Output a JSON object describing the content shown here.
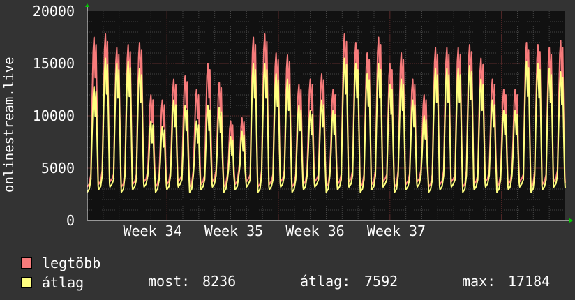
{
  "chart_data": {
    "type": "line",
    "ylabel": "onlinestream.live",
    "ylim": [
      0,
      20000
    ],
    "y_ticks": [
      "0",
      "5000",
      "10000",
      "15000",
      "20000"
    ],
    "x_ticks": [
      "Week 34",
      "Week 35",
      "Week 36",
      "Week 37"
    ],
    "grid": true,
    "x_days": 30,
    "series": [
      {
        "name": "legtöbb",
        "color": "#f77b7b",
        "daily_peaks": [
          17500,
          17800,
          16500,
          16800,
          17000,
          12000,
          11500,
          13500,
          13800,
          12500,
          15000,
          13200,
          9500,
          9800,
          17500,
          17800,
          16000,
          15800,
          13000,
          13500,
          14000,
          12500,
          17800,
          17000,
          16000,
          17500,
          15000,
          16000,
          13500,
          12000,
          16500,
          16500,
          16500,
          16800,
          15500,
          13500,
          12500,
          12500,
          17000,
          16800,
          16500,
          17200
        ]
      },
      {
        "name": "átlag",
        "color": "#ffff80",
        "daily_peaks": [
          12800,
          15500,
          15000,
          15200,
          14500,
          9500,
          9000,
          11500,
          11000,
          9500,
          11000,
          10800,
          8000,
          8500,
          15000,
          15000,
          14000,
          13500,
          11000,
          10500,
          11500,
          10500,
          15500,
          15000,
          14000,
          15000,
          13000,
          13500,
          11500,
          10000,
          14500,
          14500,
          14500,
          14800,
          13500,
          11500,
          10500,
          10500,
          15200,
          15000,
          14500,
          14200
        ]
      }
    ]
  },
  "legend": {
    "series1_label": "legtöbb",
    "series2_label": "átlag",
    "current_label": "most:",
    "current_value": "8236",
    "avg_label": "átlag:",
    "avg_value": "7592",
    "max_label": "max:",
    "max_value": "17184"
  },
  "colors": {
    "background": "#333333",
    "plot_background": "#111111",
    "grid": "#444444",
    "grid_major": "#5a2a2a",
    "axis_arrow": "#00cc00"
  }
}
